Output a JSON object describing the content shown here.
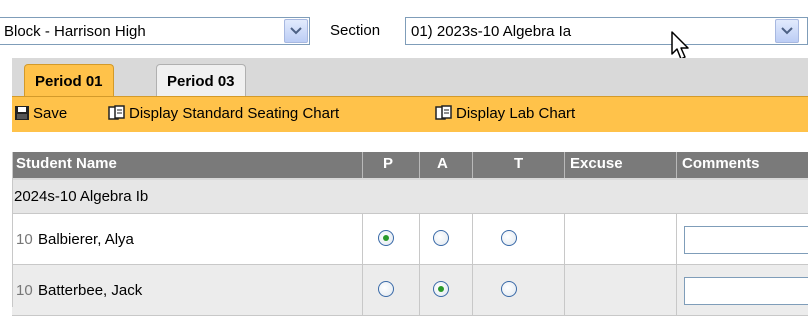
{
  "filters": {
    "block_value": "Block - Harrison High",
    "section_label": "Section",
    "section_value": "01) 2023s-10 Algebra Ia"
  },
  "tabs": [
    {
      "label": "Period 01",
      "active": true
    },
    {
      "label": "Period 03",
      "active": false
    }
  ],
  "toolbar": {
    "save_label": "Save",
    "standard_chart_label": "Display Standard Seating Chart",
    "lab_chart_label": "Display Lab Chart"
  },
  "table": {
    "columns": [
      "Student Name",
      "P",
      "A",
      "T",
      "Excuse",
      "Comments"
    ],
    "group_label": "2024s-10 Algebra Ib",
    "rows": [
      {
        "grade": "10",
        "name": "Balbierer, Alya",
        "attendance": "P"
      },
      {
        "grade": "10",
        "name": "Batterbee, Jack",
        "attendance": "A"
      }
    ]
  },
  "colors": {
    "accent": "#ffc24a",
    "header": "#7a7a7a",
    "selected_radio": "#2a9a2a"
  }
}
